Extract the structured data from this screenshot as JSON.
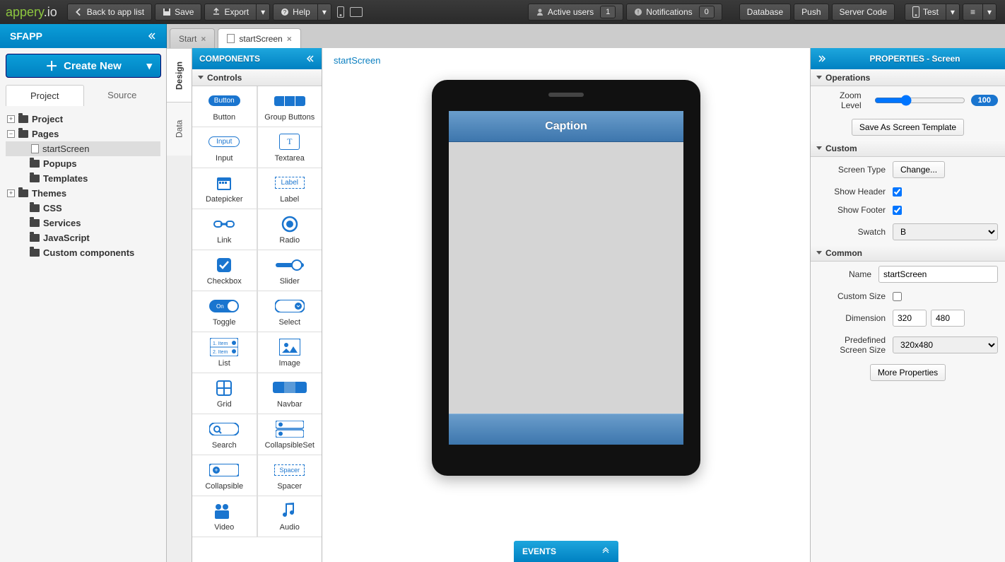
{
  "topbar": {
    "logo_left": "appery",
    "logo_right": ".io",
    "back": "Back to app list",
    "save": "Save",
    "export": "Export",
    "help": "Help",
    "active_users_label": "Active users",
    "active_users_count": "1",
    "notifications_label": "Notifications",
    "notifications_count": "0",
    "database": "Database",
    "push": "Push",
    "server_code": "Server Code",
    "test": "Test"
  },
  "app": {
    "name": "SFAPP"
  },
  "left": {
    "create": "Create New",
    "tab_project": "Project",
    "tab_source": "Source",
    "tree": {
      "project": "Project",
      "pages": "Pages",
      "startscreen": "startScreen",
      "popups": "Popups",
      "templates": "Templates",
      "themes": "Themes",
      "css": "CSS",
      "services": "Services",
      "javascript": "JavaScript",
      "custom": "Custom components"
    }
  },
  "tabs": {
    "start": "Start",
    "startscreen": "startScreen"
  },
  "vtabs": {
    "design": "Design",
    "data": "Data"
  },
  "palette": {
    "title": "COMPONENTS",
    "controls": "Controls",
    "items": [
      [
        "Button",
        "Group Buttons"
      ],
      [
        "Input",
        "Textarea"
      ],
      [
        "Datepicker",
        "Label"
      ],
      [
        "Link",
        "Radio"
      ],
      [
        "Checkbox",
        "Slider"
      ],
      [
        "Toggle",
        "Select"
      ],
      [
        "List",
        "Image"
      ],
      [
        "Grid",
        "Navbar"
      ],
      [
        "Search",
        "CollapsibleSet"
      ],
      [
        "Collapsible",
        "Spacer"
      ],
      [
        "Video",
        "Audio"
      ]
    ]
  },
  "canvas": {
    "breadcrumb": "startScreen",
    "caption": "Caption"
  },
  "events": {
    "label": "EVENTS"
  },
  "props": {
    "title": "PROPERTIES - Screen",
    "operations": "Operations",
    "zoom_label": "Zoom Level",
    "zoom_value": "100",
    "save_template": "Save As Screen Template",
    "custom": "Custom",
    "screen_type": "Screen Type",
    "change": "Change...",
    "show_header": "Show Header",
    "show_footer": "Show Footer",
    "swatch": "Swatch",
    "swatch_val": "B",
    "common": "Common",
    "name": "Name",
    "name_val": "startScreen",
    "custom_size": "Custom Size",
    "dimension": "Dimension",
    "dim_w": "320",
    "dim_h": "480",
    "predef": "Predefined Screen Size",
    "predef_val": "320x480",
    "more": "More Properties"
  }
}
